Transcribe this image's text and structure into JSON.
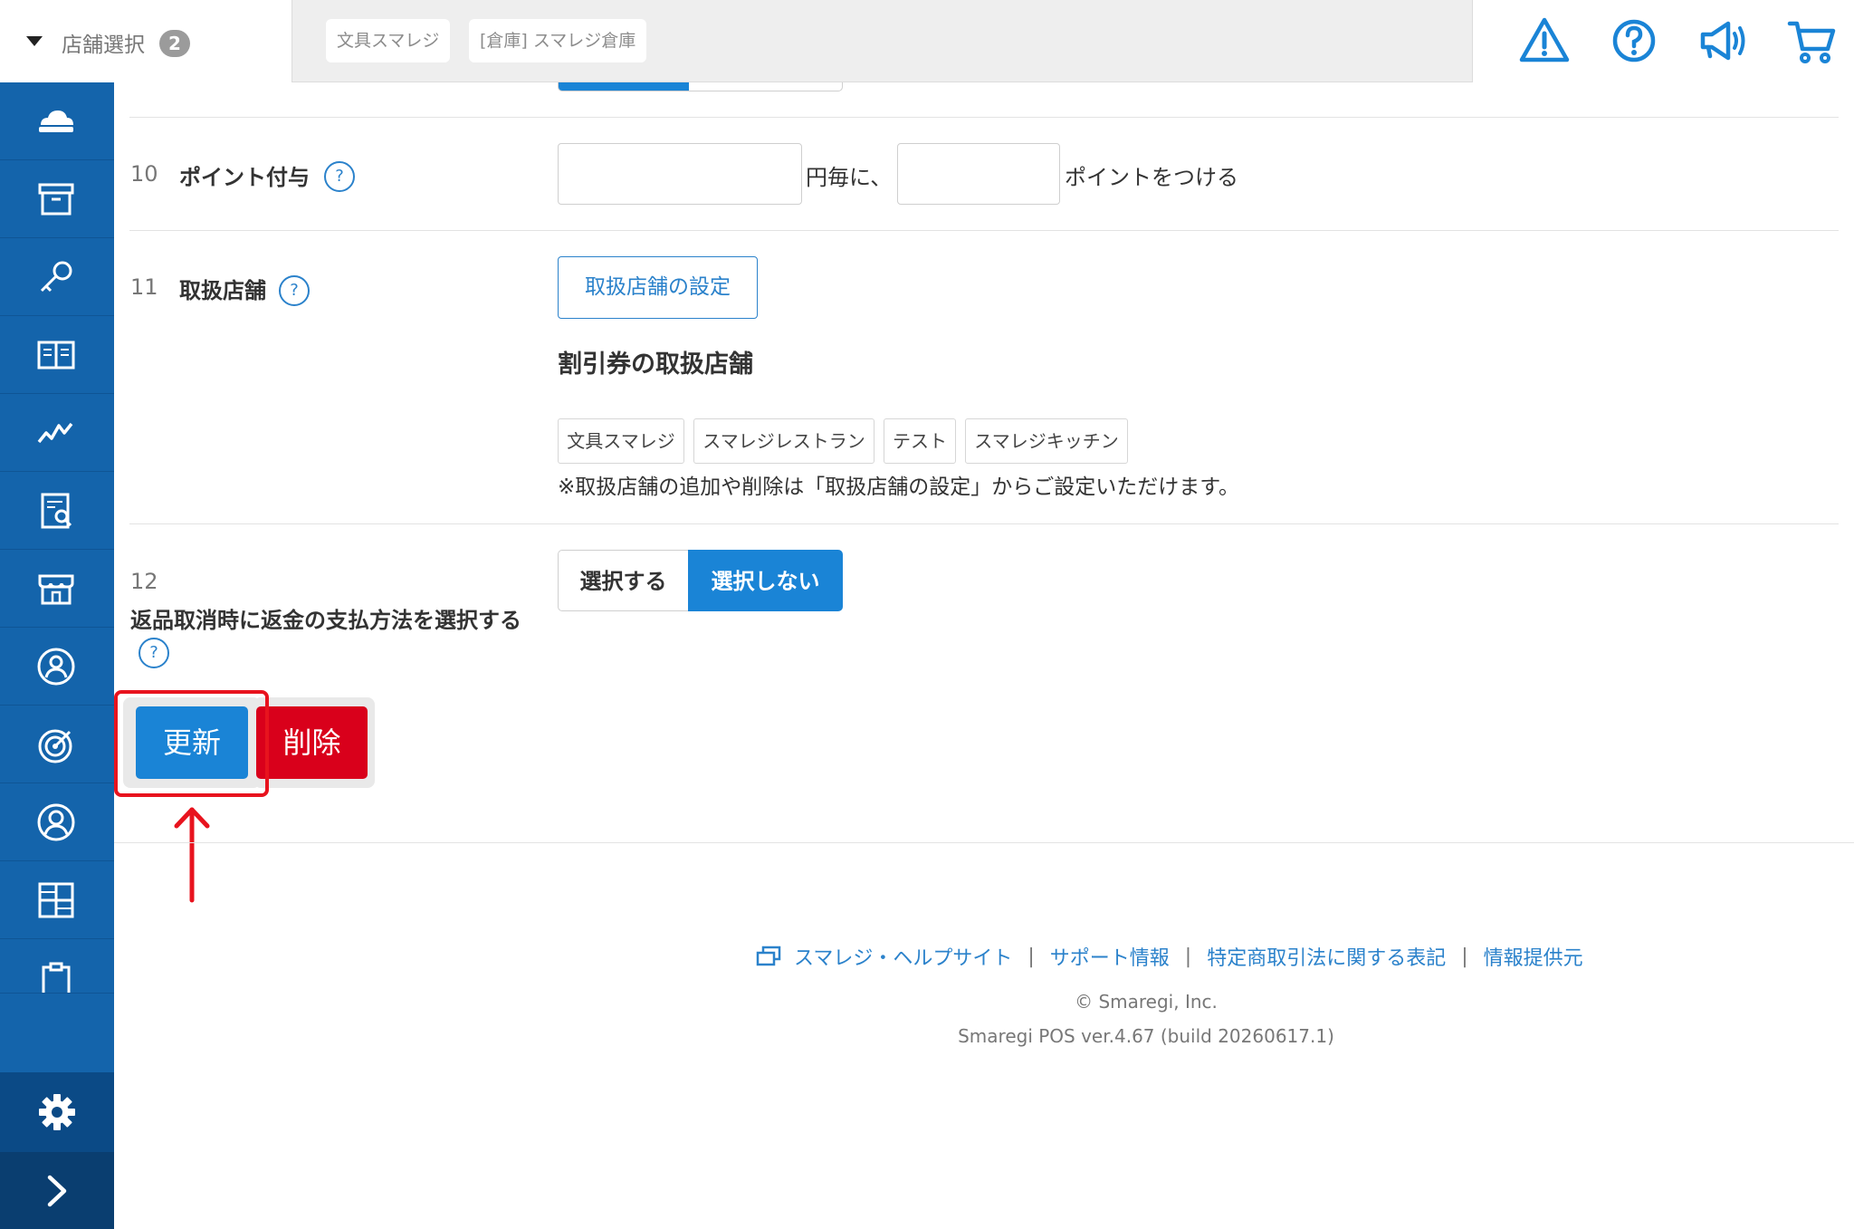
{
  "header": {
    "store_select_label": "店舗選択",
    "store_count": "2",
    "selected_stores": [
      "文具スマレジ",
      "[倉庫] スマレジ倉庫"
    ],
    "icons": [
      "warning-icon",
      "help-icon",
      "megaphone-icon",
      "cart-icon"
    ]
  },
  "sidebar": {
    "items": [
      "cloud-icon",
      "archive-box-icon",
      "key-icon",
      "book-icon",
      "chart-line-icon",
      "report-icon",
      "store-icon",
      "customer-icon",
      "target-icon",
      "user-icon",
      "grid-icon",
      "clipboard-icon"
    ],
    "bottom": [
      "settings-gear-icon",
      "expand-chevron-icon"
    ]
  },
  "form": {
    "rows": [
      {
        "number": "10",
        "label": "ポイント付与",
        "help": "?",
        "amount_value": "",
        "text_middle": "円毎に、",
        "points_value": "",
        "text_end": "ポイントをつける"
      },
      {
        "number": "11",
        "label": "取扱店舗",
        "help": "?",
        "button": "取扱店舗の設定",
        "subheading": "割引券の取扱店舗",
        "stores": [
          "文具スマレジ",
          "スマレジレストラン",
          "テスト",
          "スマレジキッチン"
        ],
        "note": "※取扱店舗の追加や削除は「取扱店舗の設定」からご設定いただけます。"
      },
      {
        "number": "12",
        "label": "返品取消時に返金の支払方法を選択する",
        "help": "?",
        "options": [
          "選択する",
          "選択しない"
        ],
        "selected": "選択しない"
      }
    ],
    "actions": {
      "update": "更新",
      "delete": "削除"
    }
  },
  "footer": {
    "links": [
      "スマレジ・ヘルプサイト",
      "サポート情報",
      "特定商取引法に関する表記",
      "情報提供元"
    ],
    "copyright": "© Smaregi, Inc.",
    "version": "Smaregi POS ver.4.67 (build 20260617.1)"
  },
  "colors": {
    "primary": "#1a84d6",
    "sidebar": "#1464ab",
    "danger": "#d9001b",
    "annotation": "#e8131e",
    "link": "#2b82cb"
  }
}
